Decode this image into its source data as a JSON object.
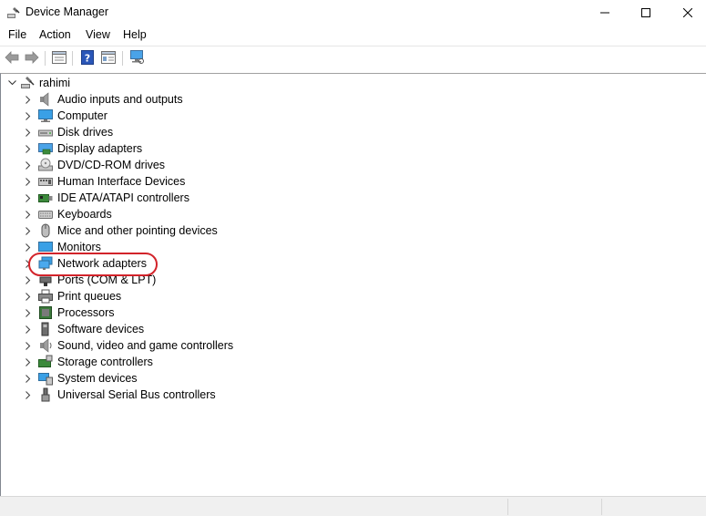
{
  "window": {
    "title": "Device Manager",
    "icon": "device-manager-icon"
  },
  "menu": {
    "file": "File",
    "action": "Action",
    "view": "View",
    "help": "Help"
  },
  "toolbar": {
    "buttons": [
      "back-arrow-icon",
      "forward-arrow-icon",
      "properties-icon",
      "help-icon",
      "view-icon",
      "scan-hardware-icon"
    ]
  },
  "tree": {
    "root": "rahimi",
    "items": [
      {
        "label": "Audio inputs and outputs",
        "icon": "speaker-icon"
      },
      {
        "label": "Computer",
        "icon": "computer-icon"
      },
      {
        "label": "Disk drives",
        "icon": "disk-drive-icon"
      },
      {
        "label": "Display adapters",
        "icon": "display-adapter-icon"
      },
      {
        "label": "DVD/CD-ROM drives",
        "icon": "dvd-drive-icon"
      },
      {
        "label": "Human Interface Devices",
        "icon": "hid-icon"
      },
      {
        "label": "IDE ATA/ATAPI controllers",
        "icon": "ide-controller-icon"
      },
      {
        "label": "Keyboards",
        "icon": "keyboard-icon"
      },
      {
        "label": "Mice and other pointing devices",
        "icon": "mouse-icon"
      },
      {
        "label": "Monitors",
        "icon": "monitor-icon"
      },
      {
        "label": "Network adapters",
        "icon": "network-adapter-icon"
      },
      {
        "label": "Ports (COM & LPT)",
        "icon": "port-icon"
      },
      {
        "label": "Print queues",
        "icon": "printer-icon"
      },
      {
        "label": "Processors",
        "icon": "processor-icon"
      },
      {
        "label": "Software devices",
        "icon": "software-device-icon"
      },
      {
        "label": "Sound, video and game controllers",
        "icon": "sound-icon"
      },
      {
        "label": "Storage controllers",
        "icon": "storage-controller-icon"
      },
      {
        "label": "System devices",
        "icon": "system-device-icon"
      },
      {
        "label": "Universal Serial Bus controllers",
        "icon": "usb-icon"
      }
    ]
  },
  "colors": {
    "highlight": "#d2232a",
    "accent": "#2d7fd3"
  }
}
